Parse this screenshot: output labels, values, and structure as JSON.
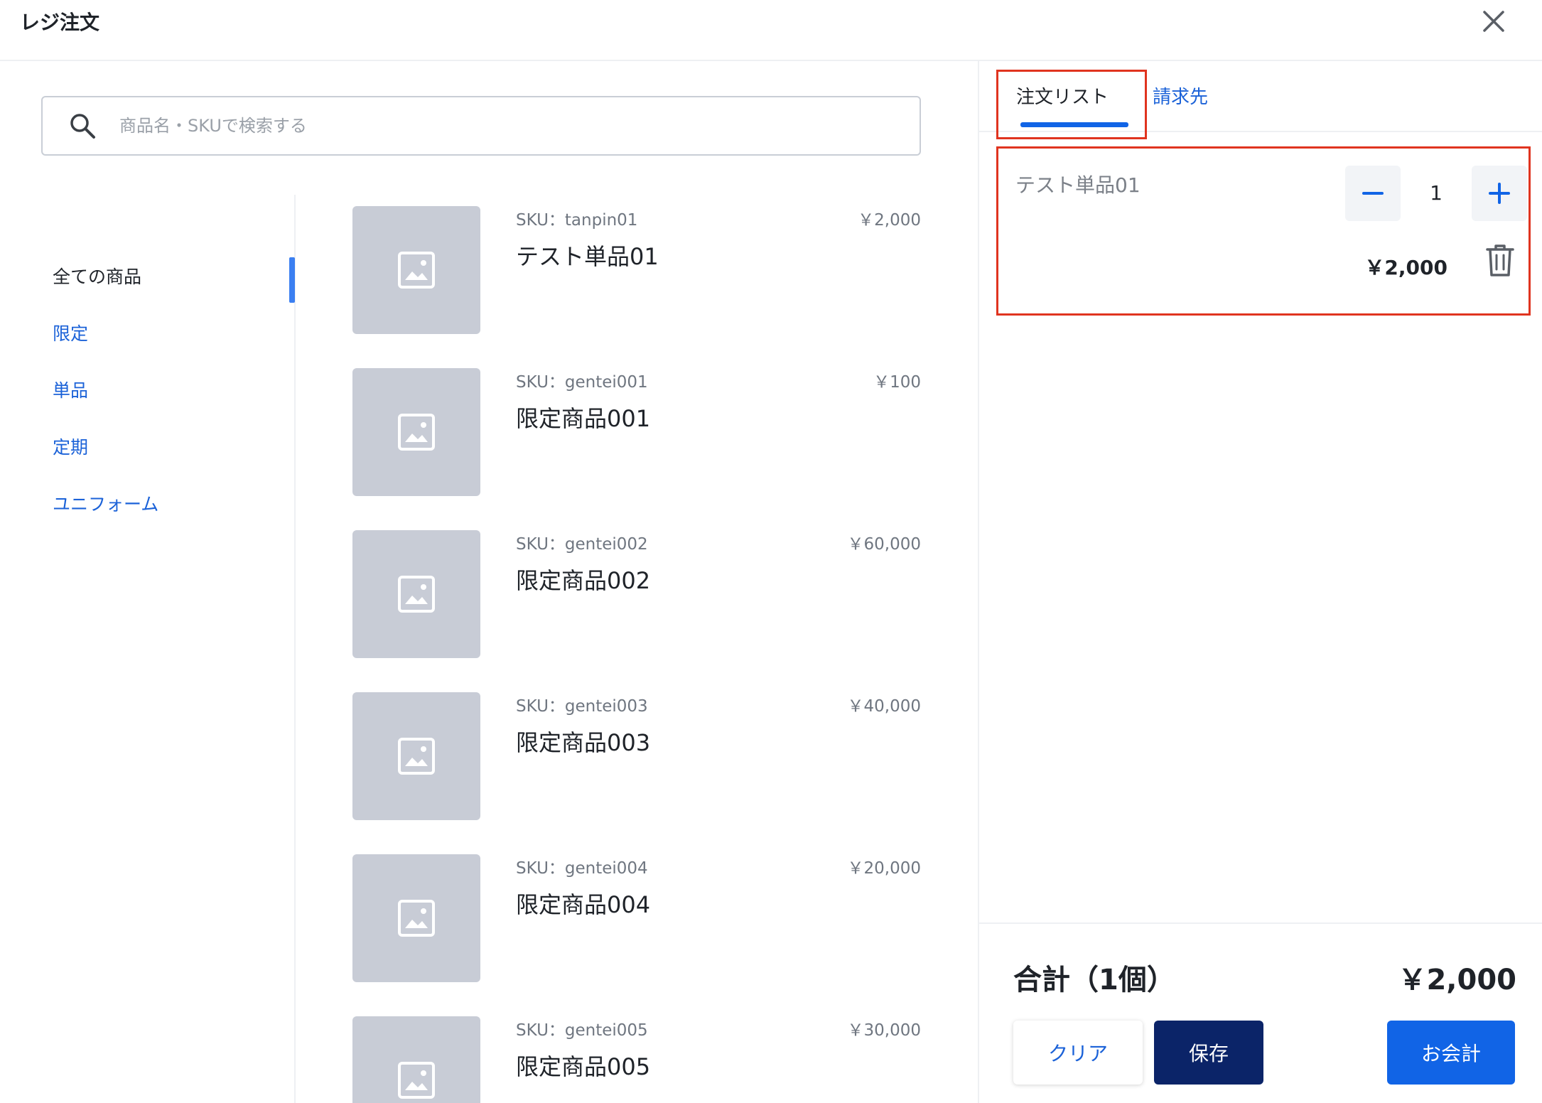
{
  "header": {
    "title": "レジ注文",
    "close_icon": "close-icon"
  },
  "search": {
    "placeholder": "商品名・SKUで検索する",
    "value": ""
  },
  "categories": [
    {
      "label": "全ての商品",
      "active": true
    },
    {
      "label": "限定",
      "active": false
    },
    {
      "label": "単品",
      "active": false
    },
    {
      "label": "定期",
      "active": false
    },
    {
      "label": "ユニフォーム",
      "active": false
    }
  ],
  "products": [
    {
      "sku": "SKU：tanpin01",
      "name": "テスト単品01",
      "price": "￥2,000"
    },
    {
      "sku": "SKU：gentei001",
      "name": "限定商品001",
      "price": "￥100"
    },
    {
      "sku": "SKU：gentei002",
      "name": "限定商品002",
      "price": "￥60,000"
    },
    {
      "sku": "SKU：gentei003",
      "name": "限定商品003",
      "price": "￥40,000"
    },
    {
      "sku": "SKU：gentei004",
      "name": "限定商品004",
      "price": "￥20,000"
    },
    {
      "sku": "SKU：gentei005",
      "name": "限定商品005",
      "price": "￥30,000"
    }
  ],
  "tabs": {
    "order_list": "注文リスト",
    "billing": "請求先",
    "active": "order_list"
  },
  "cart": {
    "items": [
      {
        "name": "テスト単品01",
        "quantity": "1",
        "price": "￥2,000"
      }
    ]
  },
  "footer": {
    "total_label": "合計（1個）",
    "total_value": "￥2,000",
    "clear_label": "クリア",
    "save_label": "保存",
    "checkout_label": "お会計"
  },
  "colors": {
    "accent": "#1164e6",
    "link": "#1b62d8",
    "save_button": "#0b2468",
    "highlight_border": "#e0341f",
    "thumbnail_placeholder": "#c8ccd6"
  }
}
